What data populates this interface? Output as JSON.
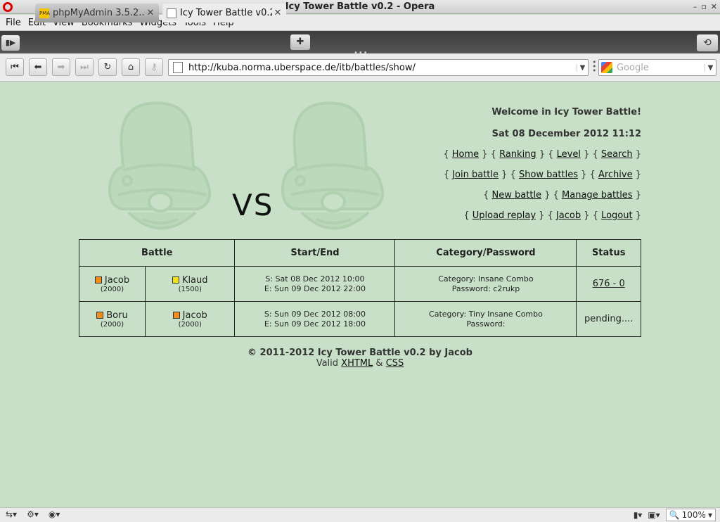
{
  "window": {
    "title": "Icy Tower Battle v0.2 - Opera"
  },
  "menu": [
    "File",
    "Edit",
    "View",
    "Bookmarks",
    "Widgets",
    "Tools",
    "Help"
  ],
  "tabs": [
    {
      "label": "phpMyAdmin 3.5.2...",
      "favicon": "PMA"
    },
    {
      "label": "Icy Tower Battle v0.2"
    }
  ],
  "address": {
    "url": "http://kuba.norma.uberspace.de/itb/battles/show/"
  },
  "search": {
    "placeholder": "Google"
  },
  "page": {
    "vs": "VS",
    "welcome": "Welcome in Icy Tower Battle!",
    "date": "Sat 08 December 2012 11:12",
    "nav1": [
      "Home",
      "Ranking",
      "Level",
      "Search"
    ],
    "nav2": [
      "Join battle",
      "Show battles",
      "Archive"
    ],
    "nav3": [
      "New battle",
      "Manage battles"
    ],
    "nav4": [
      "Upload replay",
      "Jacob",
      "Logout"
    ]
  },
  "table": {
    "headers": [
      "Battle",
      "Start/End",
      "Category/Password",
      "Status"
    ],
    "rows": [
      {
        "p1": {
          "name": "Jacob",
          "rating": "(2000)",
          "color": "#f08c1a"
        },
        "p2": {
          "name": "Klaud",
          "rating": "(1500)",
          "color": "#f2e21c"
        },
        "start": "S: Sat 08 Dec 2012 10:00",
        "end": "E: Sun 09 Dec 2012 22:00",
        "category": "Category: Insane Combo",
        "password": "Password: c2rukp",
        "status": "676 - 0"
      },
      {
        "p1": {
          "name": "Boru",
          "rating": "(2000)",
          "color": "#f08c1a"
        },
        "p2": {
          "name": "Jacob",
          "rating": "(2000)",
          "color": "#f08c1a"
        },
        "start": "S: Sun 09 Dec 2012 08:00",
        "end": "E: Sun 09 Dec 2012 18:00",
        "category": "Category: Tiny Insane Combo",
        "password": "Password:",
        "status": "pending...."
      }
    ]
  },
  "footer": {
    "copyright": "© 2011-2012 Icy Tower Battle v0.2 by Jacob",
    "valid": "Valid",
    "xhtml": "XHTML",
    "amp": "&",
    "css": "CSS"
  },
  "statusbar": {
    "zoom": "100%"
  },
  "colors": {
    "page_bg": "#c8e0c8",
    "mascot": "#b4d4b4"
  }
}
